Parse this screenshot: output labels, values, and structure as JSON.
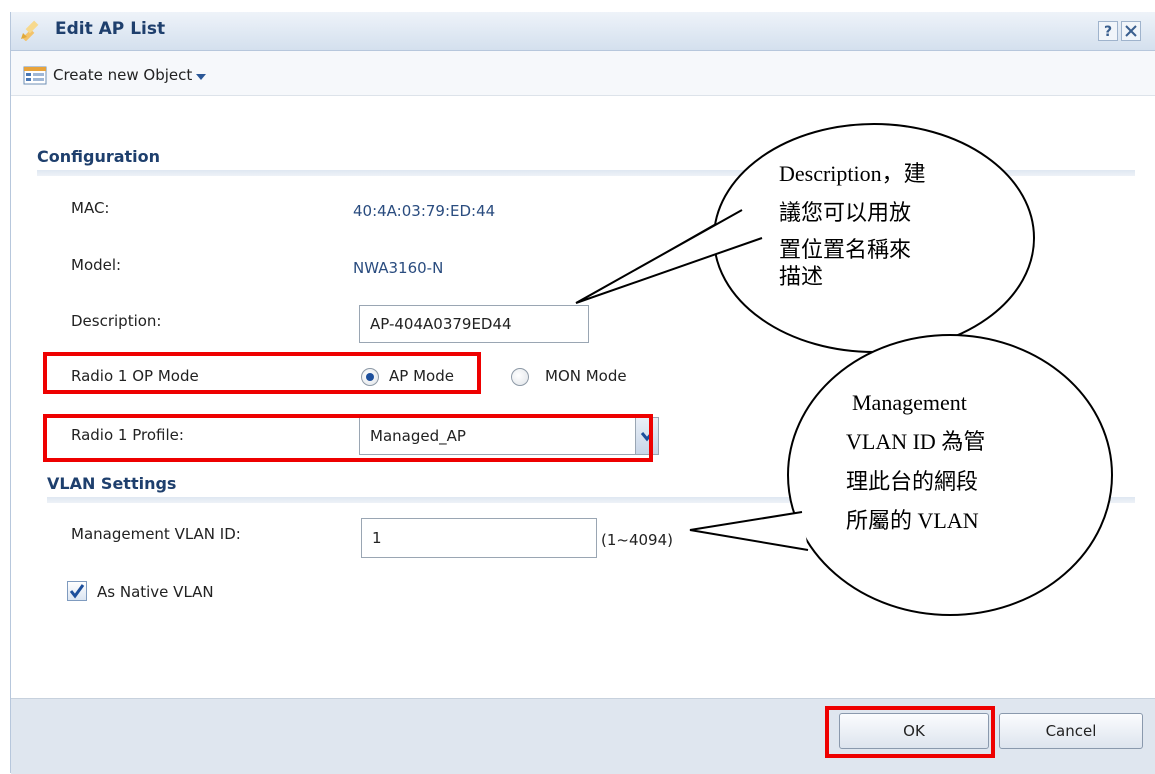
{
  "dialog": {
    "title": "Edit AP List",
    "help_label": "?"
  },
  "toolbar": {
    "create_label": "Create new Object"
  },
  "configuration": {
    "section_title": "Configuration",
    "mac_label": "MAC:",
    "mac_value": "40:4A:03:79:ED:44",
    "model_label": "Model:",
    "model_value": "NWA3160-N",
    "description_label": "Description:",
    "description_value": "AP-404A0379ED44",
    "radio_op_label": "Radio 1 OP Mode",
    "ap_mode_label": "AP Mode",
    "ap_mode_selected": true,
    "mon_mode_label": "MON Mode",
    "radio_profile_label": "Radio 1 Profile:",
    "radio_profile_value": "Managed_AP"
  },
  "vlan": {
    "section_title": "VLAN Settings",
    "mgmt_label": "Management VLAN ID:",
    "mgmt_value": "1",
    "mgmt_range": "(1~4094)",
    "native_label": "As Native VLAN",
    "native_checked": true
  },
  "footer": {
    "ok_label": "OK",
    "cancel_label": "Cancel"
  },
  "callouts": {
    "description_note": [
      "Description，建",
      "議您可以用放",
      "置位置名稱來",
      "描述"
    ],
    "vlan_note": [
      "Management",
      "VLAN ID 為管",
      "理此台的網段",
      "所屬的 VLAN"
    ]
  },
  "colors": {
    "highlight": "#ee0000",
    "title_text": "#1e3f6d",
    "value_text": "#2a4c7f"
  }
}
